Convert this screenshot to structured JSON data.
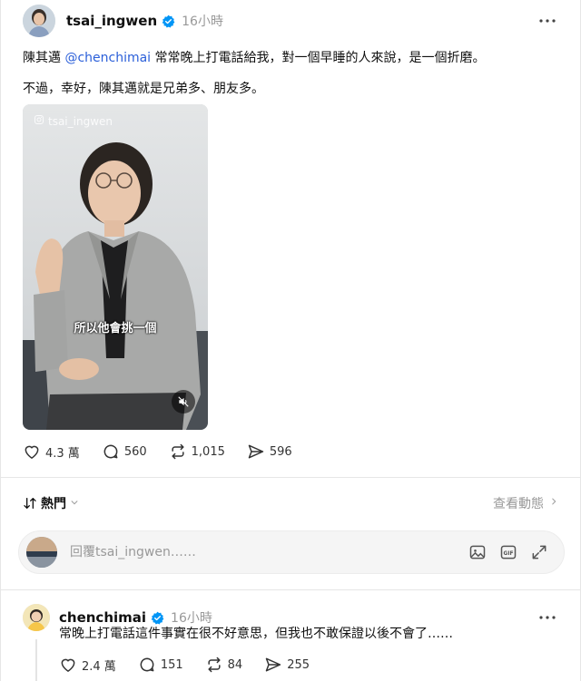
{
  "post": {
    "username": "tsai_ingwen",
    "time": "16小時",
    "text_before_mention": "陳其邁 ",
    "mention": "@chenchimai",
    "text_after_mention": " 常常晚上打電話給我，對一個早睡的人來說，是一個折磨。",
    "text_line2": "不過，幸好，陳其邁就是兄弟多、朋友多。",
    "media": {
      "watermark": "tsai_ingwen",
      "caption": "所以他會挑一個"
    },
    "stats": {
      "likes": "4.3 萬",
      "comments": "560",
      "reposts": "1,015",
      "shares": "596"
    }
  },
  "sort": {
    "label": "熱門",
    "activity_label": "查看動態"
  },
  "reply_box": {
    "placeholder": "回覆tsai_ingwen……"
  },
  "reply": {
    "username": "chenchimai",
    "time": "16小時",
    "text": "常晚上打電話這件事實在很不好意思，但我也不敢保證以後不會了……",
    "stats": {
      "likes": "2.4 萬",
      "comments": "151",
      "reposts": "84",
      "shares": "255"
    }
  },
  "colors": {
    "verified_blue": "#0095f6",
    "mention_blue": "#2b5fd9",
    "muted_text": "#999999"
  },
  "icons": [
    "verified-badge-icon",
    "more-icon",
    "heart-icon",
    "comment-icon",
    "repost-icon",
    "share-icon",
    "mute-icon",
    "sort-icon",
    "chevron-down-icon",
    "chevron-right-icon",
    "image-icon",
    "gif-icon",
    "expand-icon",
    "instagram-icon"
  ]
}
